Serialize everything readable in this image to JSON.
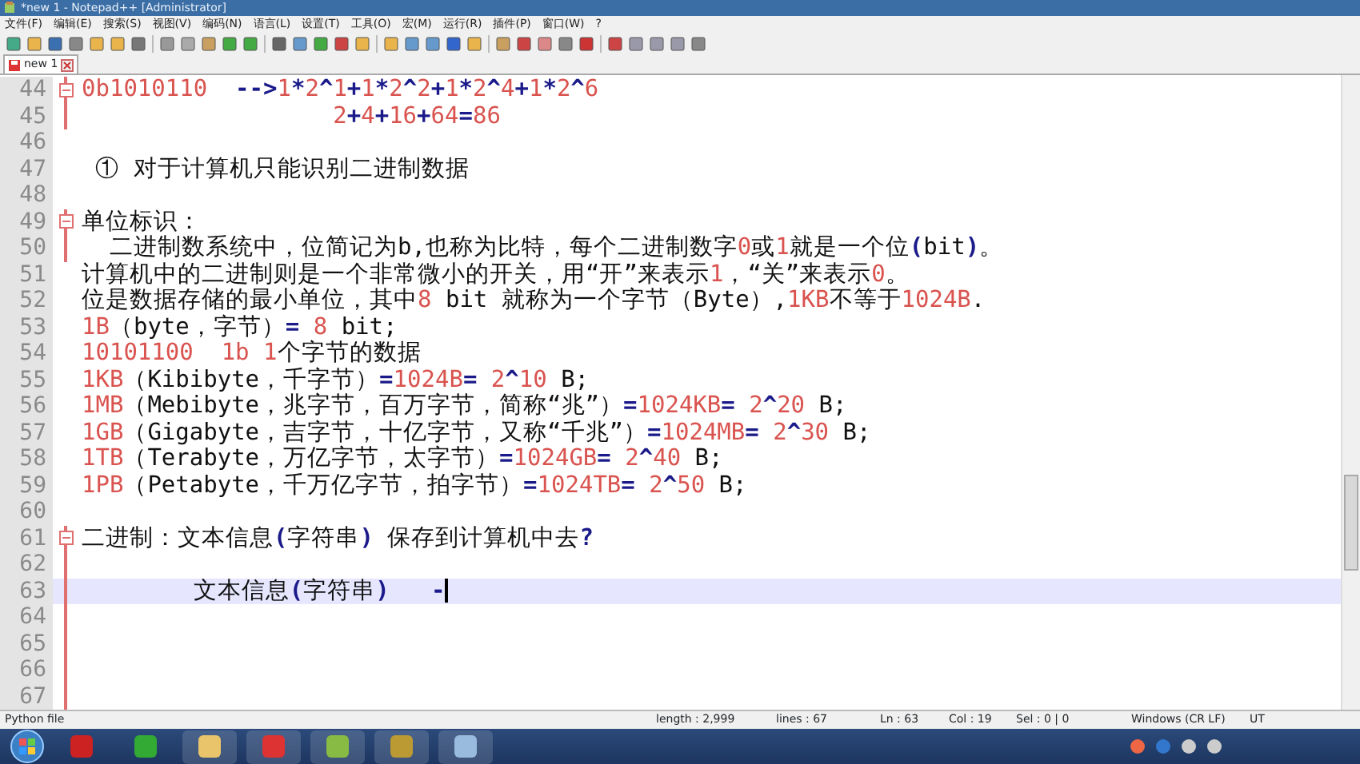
{
  "window": {
    "title": "*new 1 - Notepad++ [Administrator]"
  },
  "menu": [
    "文件(F)",
    "编辑(E)",
    "搜索(S)",
    "视图(V)",
    "编码(N)",
    "语言(L)",
    "设置(T)",
    "工具(O)",
    "宏(M)",
    "运行(R)",
    "插件(P)",
    "窗口(W)",
    "?"
  ],
  "tabs": [
    {
      "label": "new 1",
      "selected": true,
      "modified": true
    }
  ],
  "editor": {
    "lines": [
      {
        "number": "44",
        "text": "0b1010110  -->1*2^1+1*2^2+1*2^4+1*2^6",
        "fold_start": true,
        "current": false
      },
      {
        "number": "45",
        "text": "                  2+4+16+64=86",
        "fold_start": false,
        "current": false
      },
      {
        "number": "46",
        "fold_start": false,
        "current": false
      },
      {
        "number": "47",
        "text": " ① 对于计算机只能识别二进制数据",
        "fold_start": false,
        "current": false
      },
      {
        "number": "48",
        "fold_start": false,
        "current": false
      },
      {
        "number": "49",
        "text": "单位标识：",
        "fold_start": true,
        "current": false
      },
      {
        "number": "50",
        "text": "  二进制数系统中，位简记为b,也称为比特，每个二进制数字0或1就是一个位(bit)。",
        "fold_start": false,
        "current": false
      },
      {
        "number": "51",
        "text": "计算机中的二进制则是一个非常微小的开关，用“开”来表示1，“关”来表示0。",
        "fold_start": false,
        "current": false
      },
      {
        "number": "52",
        "text": "位是数据存储的最小单位，其中8 bit 就称为一个字节（Byte）,1KB不等于1024B.",
        "fold_start": false,
        "current": false
      },
      {
        "number": "53",
        "text": "1B（byte，字节）= 8 bit;",
        "fold_start": false,
        "current": false
      },
      {
        "number": "54",
        "text": "10101100  1b 1个字节的数据",
        "fold_start": false,
        "current": false
      },
      {
        "number": "55",
        "text": "1KB（Kibibyte，千字节）=1024B= 2^10 B;",
        "fold_start": false,
        "current": false
      },
      {
        "number": "56",
        "text": "1MB（Mebibyte，兆字节，百万字节，简称“兆”）=1024KB= 2^20 B;",
        "fold_start": false,
        "current": false
      },
      {
        "number": "57",
        "text": "1GB（Gigabyte，吉字节，十亿字节，又称“千兆”）=1024MB= 2^30 B;",
        "fold_start": false,
        "current": false
      },
      {
        "number": "58",
        "text": "1TB（Terabyte，万亿字节，太字节）=1024GB= 2^40 B;",
        "fold_start": false,
        "current": false
      },
      {
        "number": "59",
        "text": "1PB（Petabyte，千万亿字节，拍字节）=1024TB= 2^50 B;",
        "fold_start": false,
        "current": false
      },
      {
        "number": "60",
        "fold_start": false,
        "current": false
      },
      {
        "number": "61",
        "text": "二进制：文本信息(字符串) 保存到计算机中去?",
        "fold_start": true,
        "current": false
      },
      {
        "number": "62",
        "fold_start": false,
        "current": false
      },
      {
        "number": "63",
        "text": "        文本信息(字符串)   -",
        "fold_start": false,
        "current": true
      },
      {
        "number": "64",
        "fold_start": false,
        "current": false
      },
      {
        "number": "65",
        "fold_start": false,
        "current": false
      },
      {
        "number": "66",
        "fold_start": false,
        "current": false
      },
      {
        "number": "67",
        "fold_start": false,
        "current": false
      }
    ]
  },
  "status_bar": {
    "language": "Python file",
    "fields": [
      "length : 2,999",
      "lines : 67",
      "Ln : 63",
      "Col : 19",
      "Sel : 0 | 0",
      "Windows (CR LF)",
      "UT"
    ]
  }
}
